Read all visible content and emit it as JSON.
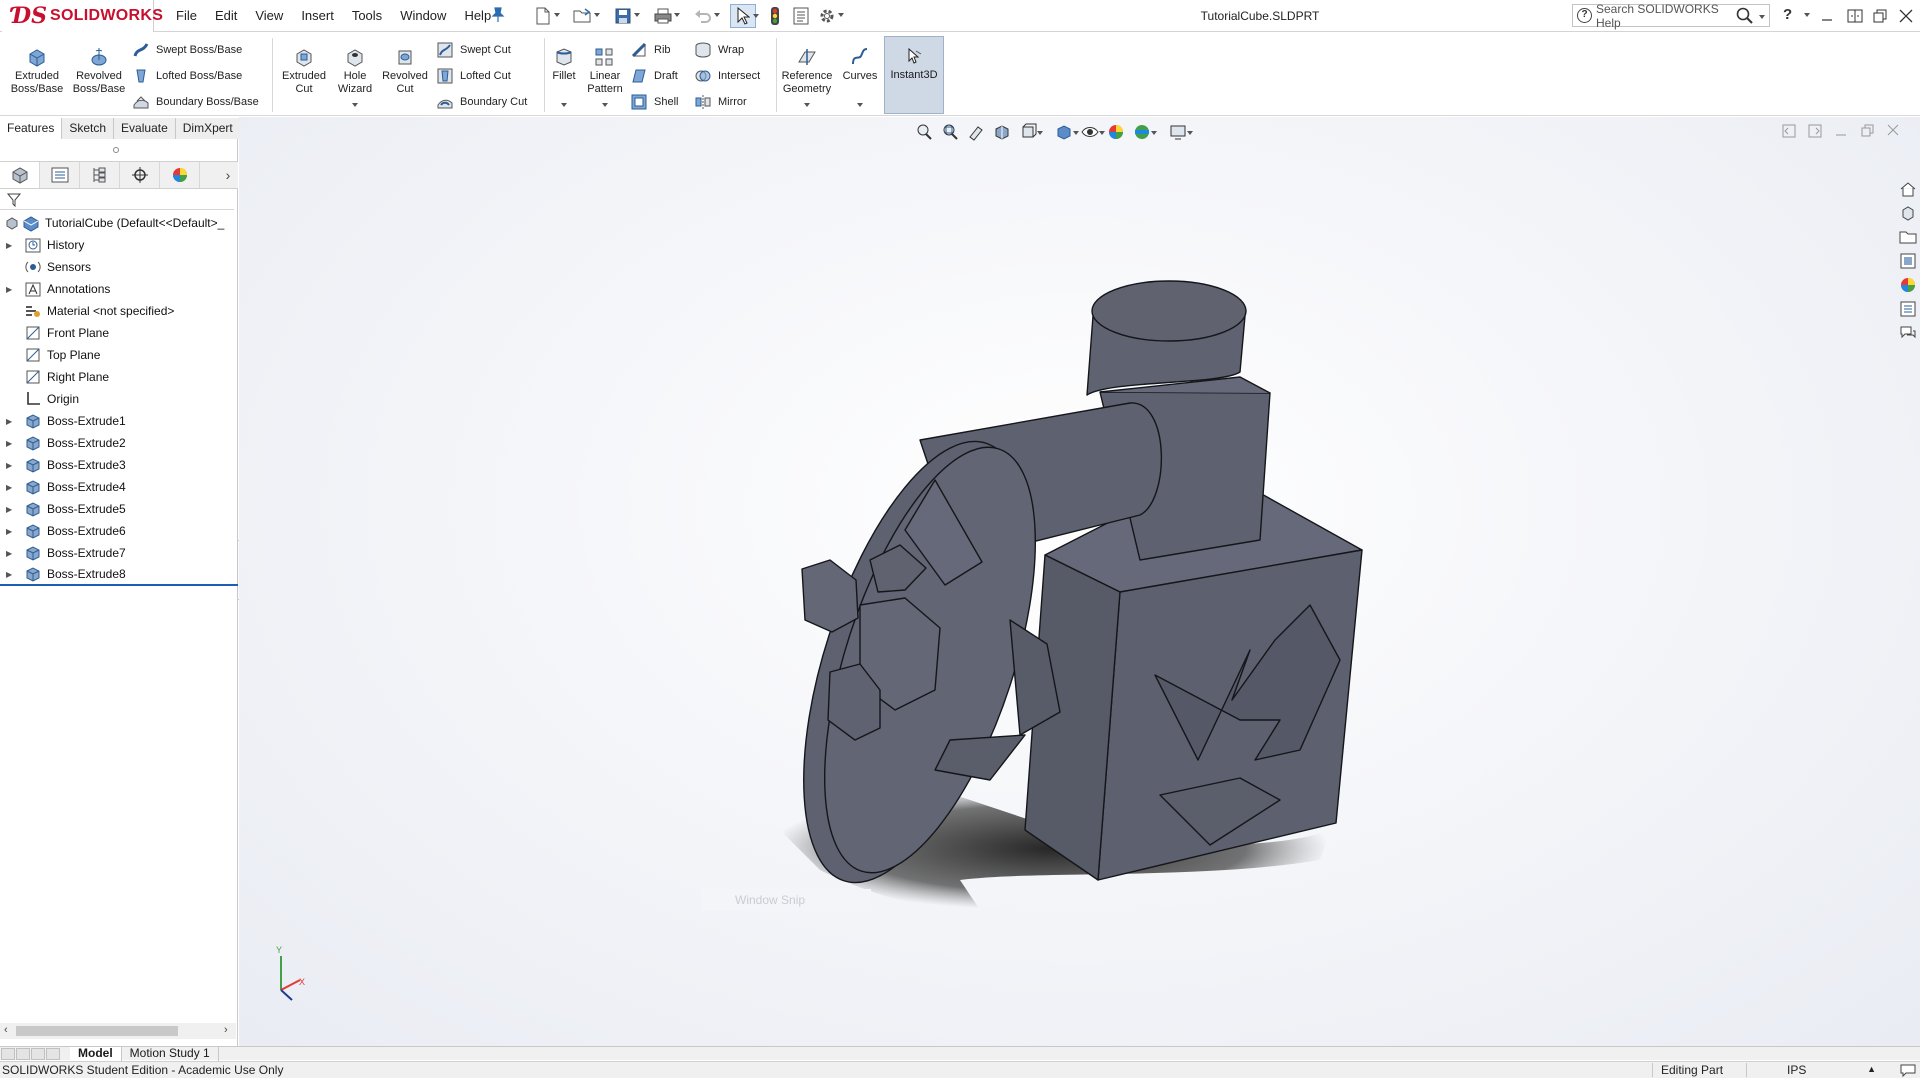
{
  "app": {
    "name": "SOLIDWORKS",
    "brand_color": "#c8102e"
  },
  "menus": [
    "File",
    "Edit",
    "View",
    "Insert",
    "Tools",
    "Window",
    "Help"
  ],
  "document_title": "TutorialCube.SLDPRT",
  "search": {
    "placeholder": "Search SOLIDWORKS Help"
  },
  "help_label": "?",
  "quick_access": [
    "new-icon",
    "open-icon",
    "save-icon",
    "print-icon",
    "undo-icon",
    "select-icon",
    "rebuild-icon",
    "file-properties-icon",
    "options-icon"
  ],
  "command_manager": {
    "extruded_boss": "Extruded Boss/Base",
    "revolved_boss": "Revolved Boss/Base",
    "swept_boss": "Swept Boss/Base",
    "lofted_boss": "Lofted Boss/Base",
    "boundary_boss": "Boundary Boss/Base",
    "extruded_cut": "Extruded Cut",
    "hole_wizard": "Hole Wizard",
    "revolved_cut": "Revolved Cut",
    "swept_cut": "Swept Cut",
    "lofted_cut": "Lofted Cut",
    "boundary_cut": "Boundary Cut",
    "fillet": "Fillet",
    "linear_pattern": "Linear Pattern",
    "rib": "Rib",
    "draft": "Draft",
    "shell": "Shell",
    "wrap": "Wrap",
    "intersect": "Intersect",
    "mirror": "Mirror",
    "reference_geometry": "Reference Geometry",
    "curves": "Curves",
    "instant3d": "Instant3D"
  },
  "cm_tabs": [
    "Features",
    "Sketch",
    "Evaluate",
    "DimXpert"
  ],
  "tree": {
    "root": "TutorialCube  (Default<<Default>_",
    "items": [
      {
        "label": "History",
        "icon": "history-icon",
        "expandable": true
      },
      {
        "label": "Sensors",
        "icon": "sensors-icon",
        "expandable": false
      },
      {
        "label": "Annotations",
        "icon": "annotations-icon",
        "expandable": true
      },
      {
        "label": "Material <not specified>",
        "icon": "material-icon",
        "expandable": false
      },
      {
        "label": "Front Plane",
        "icon": "plane-icon",
        "expandable": false
      },
      {
        "label": "Top Plane",
        "icon": "plane-icon",
        "expandable": false
      },
      {
        "label": "Right Plane",
        "icon": "plane-icon",
        "expandable": false
      },
      {
        "label": "Origin",
        "icon": "origin-icon",
        "expandable": false
      },
      {
        "label": "Boss-Extrude1",
        "icon": "extrude-icon",
        "expandable": true
      },
      {
        "label": "Boss-Extrude2",
        "icon": "extrude-icon",
        "expandable": true
      },
      {
        "label": "Boss-Extrude3",
        "icon": "extrude-icon",
        "expandable": true
      },
      {
        "label": "Boss-Extrude4",
        "icon": "extrude-icon",
        "expandable": true
      },
      {
        "label": "Boss-Extrude5",
        "icon": "extrude-icon",
        "expandable": true
      },
      {
        "label": "Boss-Extrude6",
        "icon": "extrude-icon",
        "expandable": true
      },
      {
        "label": "Boss-Extrude7",
        "icon": "extrude-icon",
        "expandable": true
      },
      {
        "label": "Boss-Extrude8",
        "icon": "extrude-icon",
        "expandable": true
      }
    ]
  },
  "graphics": {
    "window_snip_label": "Window Snip",
    "model_color": "#5f6270",
    "triad_labels": {
      "x": "X",
      "y": "Y"
    }
  },
  "bottom_tabs": [
    "Model",
    "Motion Study 1"
  ],
  "status": {
    "left": "SOLIDWORKS Student Edition - Academic Use Only",
    "mode": "Editing Part",
    "units": "IPS",
    "units_arrow": "▲"
  }
}
